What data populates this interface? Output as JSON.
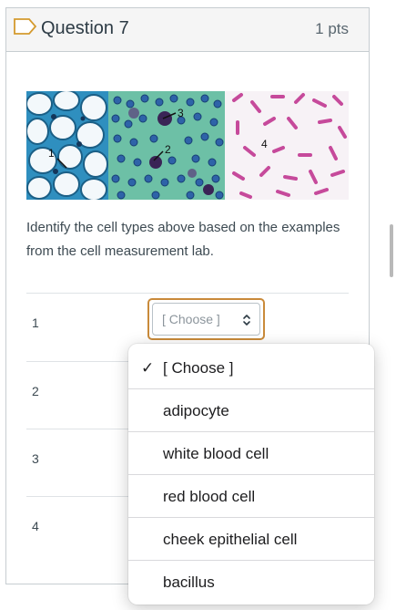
{
  "question": {
    "title": "Question 7",
    "points": "1 pts",
    "prompt": "Identify the cell types above based on the examples from the cell measurement lab.",
    "image_labels": [
      "1",
      "3",
      "2",
      "4"
    ]
  },
  "rows": [
    {
      "number": "1"
    },
    {
      "number": "2"
    },
    {
      "number": "3"
    },
    {
      "number": "4"
    }
  ],
  "select": {
    "value": "[ Choose ]"
  },
  "dropdown": {
    "check_mark": "✓",
    "options": [
      "[ Choose ]",
      "adipocyte",
      "white blood cell",
      "red blood cell",
      "cheek epithelial cell",
      "bacillus"
    ]
  },
  "colors": {
    "focus_ring": "#c98a3a",
    "adipocyte_stain": "#3aa6c9",
    "blood_background": "#6dc0a6",
    "bacillus_stain": "#c64a9b"
  }
}
